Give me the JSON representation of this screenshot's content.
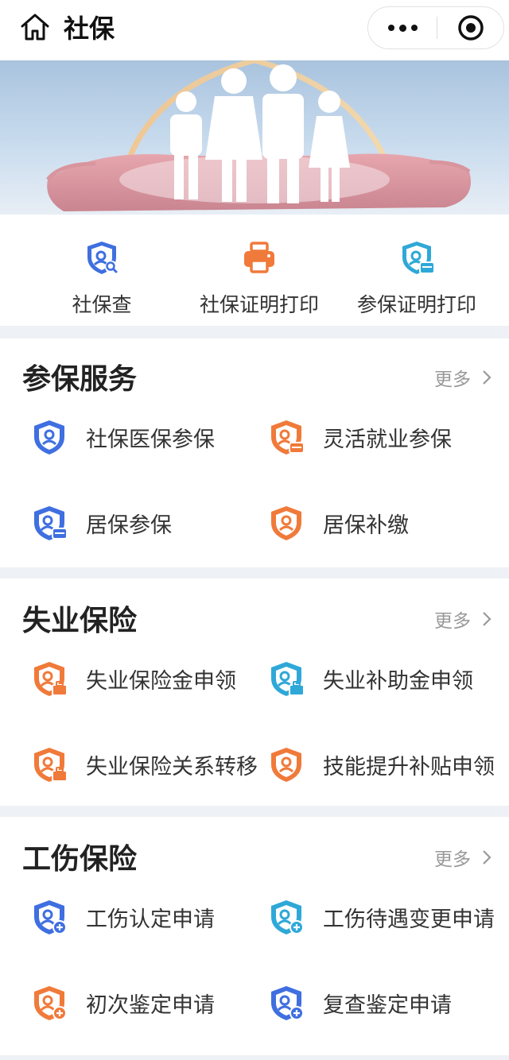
{
  "header": {
    "title": "社保",
    "home_icon": "home-icon",
    "more_icon": "more-dots-icon",
    "close_icon": "target-close-icon"
  },
  "banner": {
    "image": "family-in-hands-illustration"
  },
  "quick": {
    "items": [
      {
        "label": "社保查",
        "icon": "shield-search-icon",
        "color": "#3f6fe0"
      },
      {
        "label": "社保证明打印",
        "icon": "printer-icon",
        "color": "#f07a3a"
      },
      {
        "label": "参保证明打印",
        "icon": "shield-card-icon",
        "color": "#2fa8d8"
      }
    ]
  },
  "sections": [
    {
      "title": "参保服务",
      "more": "更多",
      "items": [
        {
          "label": "社保医保参保",
          "icon": "shield-user-icon",
          "color": "#3f6fe0"
        },
        {
          "label": "灵活就业参保",
          "icon": "shield-user-card-icon",
          "color": "#f07a3a"
        },
        {
          "label": "居保参保",
          "icon": "shield-user-card-icon",
          "color": "#3f6fe0"
        },
        {
          "label": "居保补缴",
          "icon": "shield-user-icon",
          "color": "#f07a3a"
        }
      ]
    },
    {
      "title": "失业保险",
      "more": "更多",
      "items": [
        {
          "label": "失业保险金申领",
          "icon": "shield-user-bag-icon",
          "color": "#f07a3a"
        },
        {
          "label": "失业补助金申领",
          "icon": "shield-user-bag-icon",
          "color": "#2fa8d8"
        },
        {
          "label": "失业保险关系转移",
          "icon": "shield-user-bag-icon",
          "color": "#f07a3a"
        },
        {
          "label": "技能提升补贴申领",
          "icon": "shield-user-icon",
          "color": "#f07a3a"
        }
      ]
    },
    {
      "title": "工伤保险",
      "more": "更多",
      "items": [
        {
          "label": "工伤认定申请",
          "icon": "shield-user-plus-icon",
          "color": "#3f6fe0"
        },
        {
          "label": "工伤待遇变更申请",
          "icon": "shield-user-plus-icon",
          "color": "#2fa8d8"
        },
        {
          "label": "初次鉴定申请",
          "icon": "shield-user-plus-icon",
          "color": "#f07a3a"
        },
        {
          "label": "复查鉴定申请",
          "icon": "shield-user-plus-icon",
          "color": "#3f6fe0"
        }
      ]
    }
  ]
}
